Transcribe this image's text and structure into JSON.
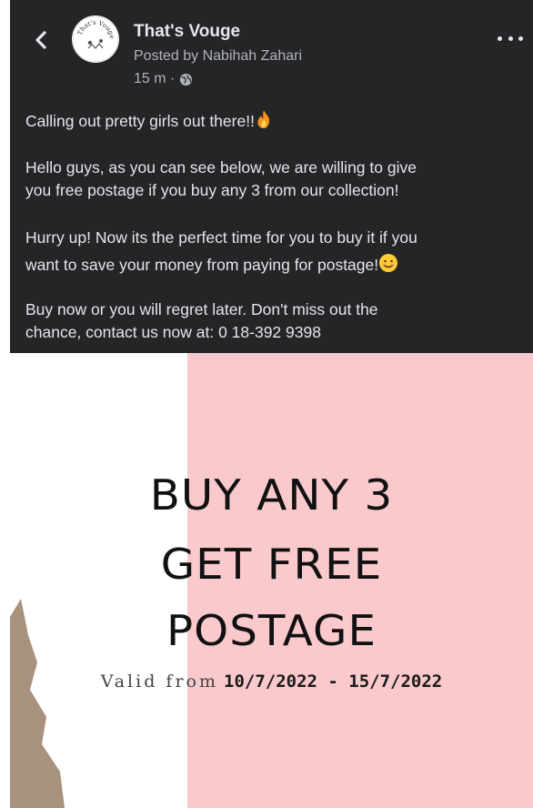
{
  "post": {
    "page_name": "That's Vouge",
    "posted_by": "Posted by Nabihah Zahari",
    "time": "15 m ·",
    "avatar_text": "That's Vouge",
    "paragraphs": {
      "p1": "Calling out pretty girls out there!!",
      "p2_line1": "Hello guys, as you can see below, we are willing to give",
      "p2_line2": "you free postage if you buy any 3 from our collection!",
      "p3_line1": "Hurry up! Now its the perfect time for you to buy it if you",
      "p3_line2": "want to save your money from paying for postage!",
      "p4_line1": "Buy now or you will regret later. Don't miss out the",
      "p4_line2": "chance, contact us now at: 0 18-392 9398"
    },
    "icons": {
      "back": "chevron-left-icon",
      "more": "more-dots-icon",
      "privacy": "globe-icon",
      "fire": "fire-emoji",
      "smile": "smiling-face-emoji"
    }
  },
  "flyer": {
    "line1": "BUY ANY 3",
    "line2": "GET FREE",
    "line3": "POSTAGE",
    "valid_label": "Valid from",
    "valid_dates": "10/7/2022 - 15/7/2022",
    "colors": {
      "pink": "#f9c9cc",
      "dark_bg": "#242526",
      "scrap": "#a8927e"
    }
  }
}
